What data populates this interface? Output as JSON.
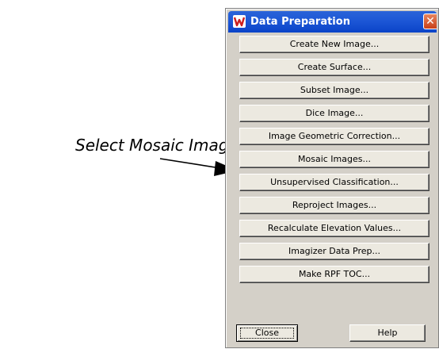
{
  "annotation": {
    "text": "Select Mosaic Images"
  },
  "window": {
    "title": "Data Preparation",
    "close_glyph": "✕",
    "title_icon": "imagine-app-icon"
  },
  "buttons": [
    "Create New Image...",
    "Create Surface...",
    "Subset Image...",
    "Dice Image...",
    "Image Geometric Correction...",
    "Mosaic Images...",
    "Unsupervised Classification...",
    "Reproject Images...",
    "Recalculate Elevation Values...",
    "Imagizer Data Prep...",
    "Make RPF TOC..."
  ],
  "footer": {
    "close_label": "Close",
    "help_label": "Help"
  },
  "colors": {
    "titlebar": "#1d57d6",
    "close_button": "#c8401a",
    "dialog_face": "#d4d0c8",
    "button_face": "#ece9e0"
  }
}
